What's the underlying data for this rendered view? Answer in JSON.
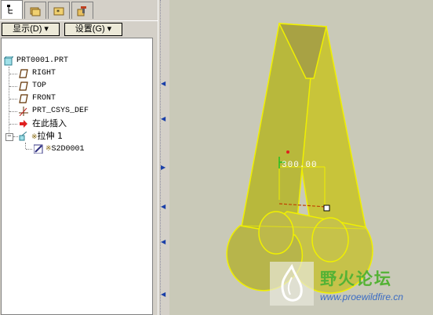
{
  "model_tree": {
    "tabs": [
      {
        "icon": "model-tree-icon"
      },
      {
        "icon": "folder-layers-icon"
      },
      {
        "icon": "folder-star-icon"
      },
      {
        "icon": "tools-icon"
      }
    ],
    "show_button": "显示(D)",
    "settings_button": "设置(G)",
    "items": [
      {
        "label": "PRT0001.PRT",
        "icon": "part-icon"
      },
      {
        "label": "RIGHT",
        "icon": "datum-plane-icon"
      },
      {
        "label": "TOP",
        "icon": "datum-plane-icon"
      },
      {
        "label": "FRONT",
        "icon": "datum-plane-icon"
      },
      {
        "label": "PRT_CSYS_DEF",
        "icon": "csys-icon"
      },
      {
        "label": "在此插入",
        "icon": "insert-here-icon"
      },
      {
        "label": "拉伸 1",
        "icon": "extrude-icon"
      },
      {
        "label": "S2D0001",
        "icon": "sketch-icon"
      }
    ]
  },
  "viewport": {
    "dimension_value": "300.00",
    "model_color": "#f0f000"
  },
  "watermark": {
    "title": "野火论坛",
    "url": "www.proewildfire.cn"
  }
}
